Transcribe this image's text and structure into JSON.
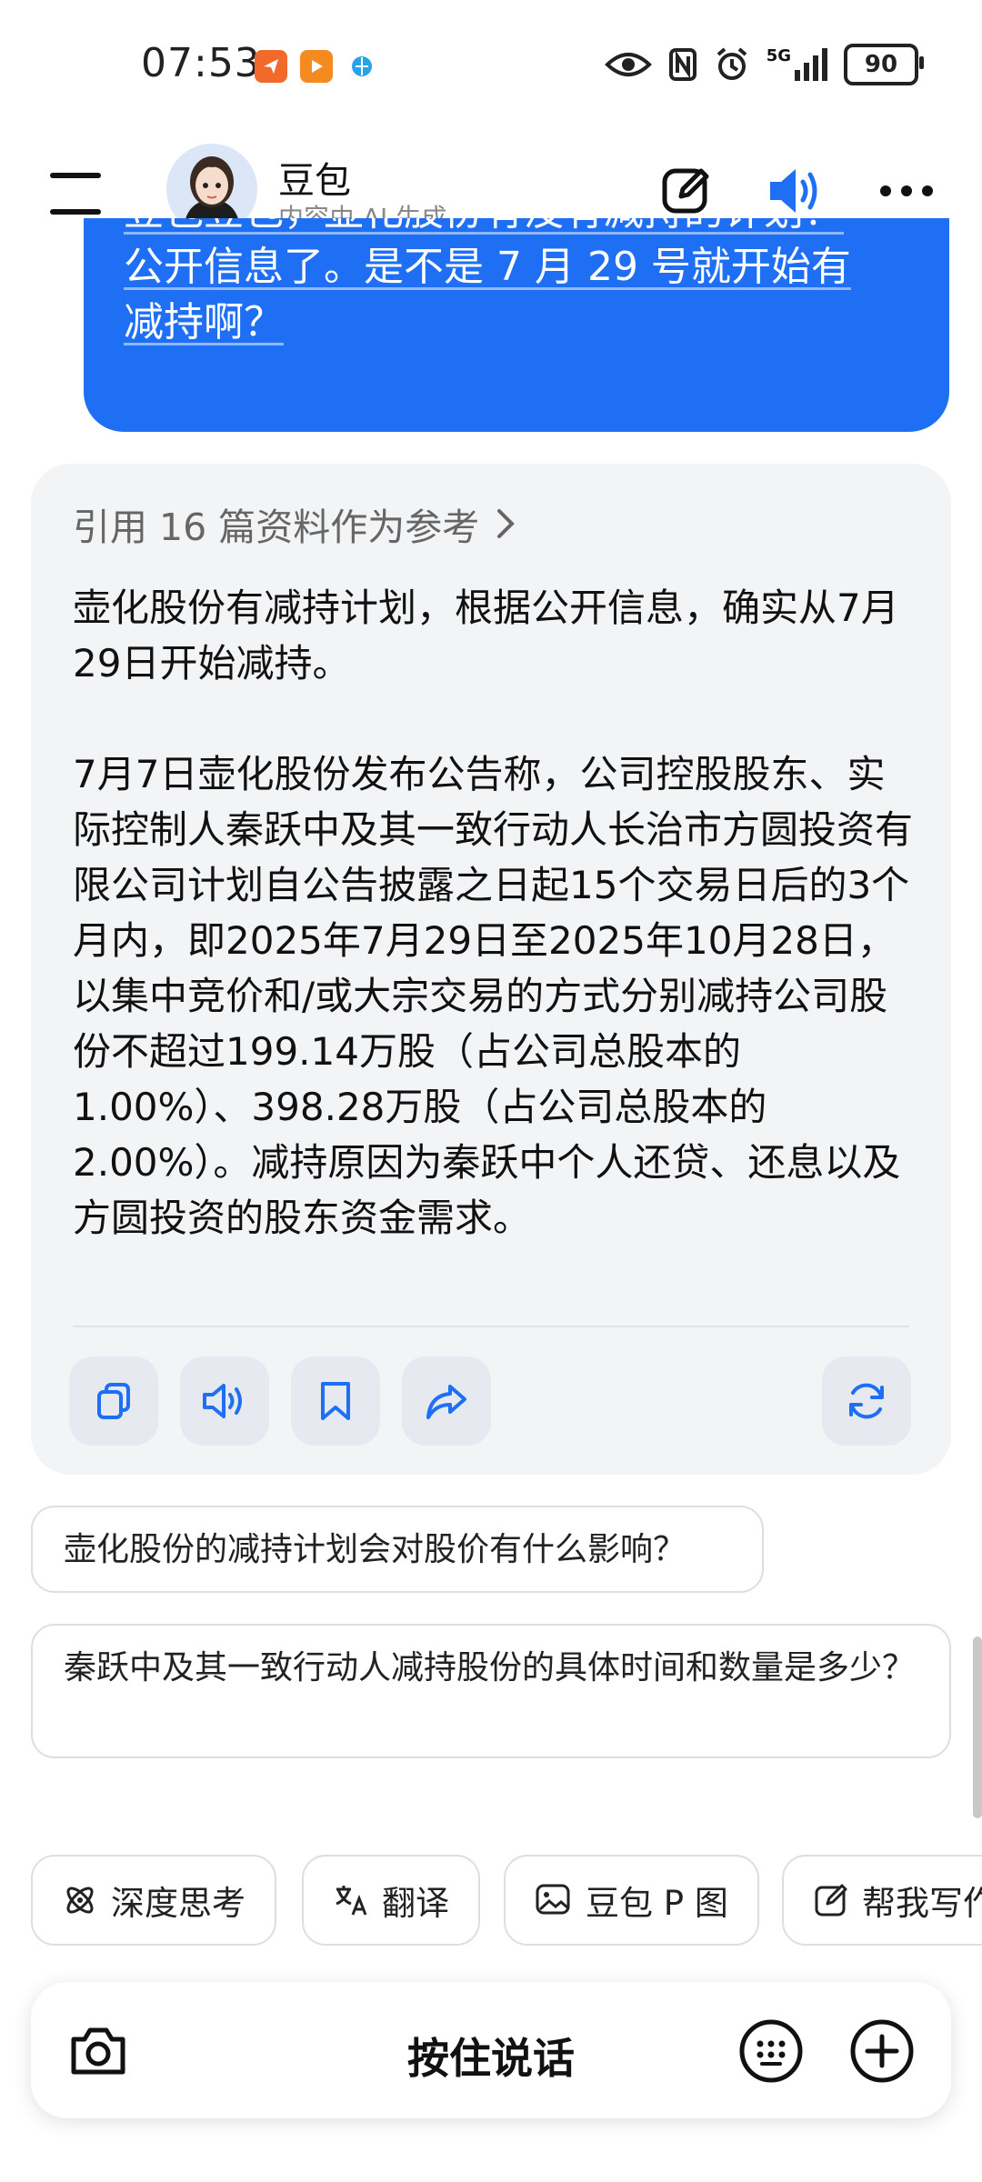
{
  "status_bar": {
    "time": "07:53",
    "network": "5G",
    "battery": "90"
  },
  "header": {
    "bot_name": "豆包",
    "subtitle": "内容由 AI 生成"
  },
  "user_message": {
    "line1": "豆包豆包，壶化股份有没有减持的计划？",
    "line2": "公开信息了。是不是 7 月 29 号就开始有",
    "line3": "减持啊？"
  },
  "assistant": {
    "references": "引用 16 篇资料作为参考",
    "paragraph1": "壶化股份有减持计划，根据公开信息，确实从7月29日开始减持。",
    "paragraph2": "7月7日壶化股份发布公告称，公司控股股东、实际控制人秦跃中及其一致行动人长治市方圆投资有限公司计划自公告披露之日起15个交易日后的3个月内，即2025年7月29日至2025年10月28日，以集中竞价和/或大宗交易的方式分别减持公司股份不超过199.14万股（占公司总股本的1.00%）、398.28万股（占公司总股本的2.00%）。减持原因为秦跃中个人还贷、还息以及方圆投资的股东资金需求。",
    "actions": [
      "copy-icon",
      "speaker-icon",
      "bookmark-icon",
      "share-icon",
      "regenerate-icon"
    ]
  },
  "suggestions": [
    "壶化股份的减持计划会对股价有什么影响？",
    "秦跃中及其一致行动人减持股份的具体时间和数量是多少？"
  ],
  "chips": [
    {
      "label": "深度思考",
      "icon": "atom-icon"
    },
    {
      "label": "翻译",
      "icon": "translate-icon"
    },
    {
      "label": "豆包 P 图",
      "icon": "image-edit-icon"
    },
    {
      "label": "帮我写作",
      "icon": "write-icon"
    }
  ],
  "input": {
    "hold_to_talk": "按住说话"
  },
  "colors": {
    "accent": "#1f6ff5",
    "card_bg": "#f3f4f6"
  }
}
